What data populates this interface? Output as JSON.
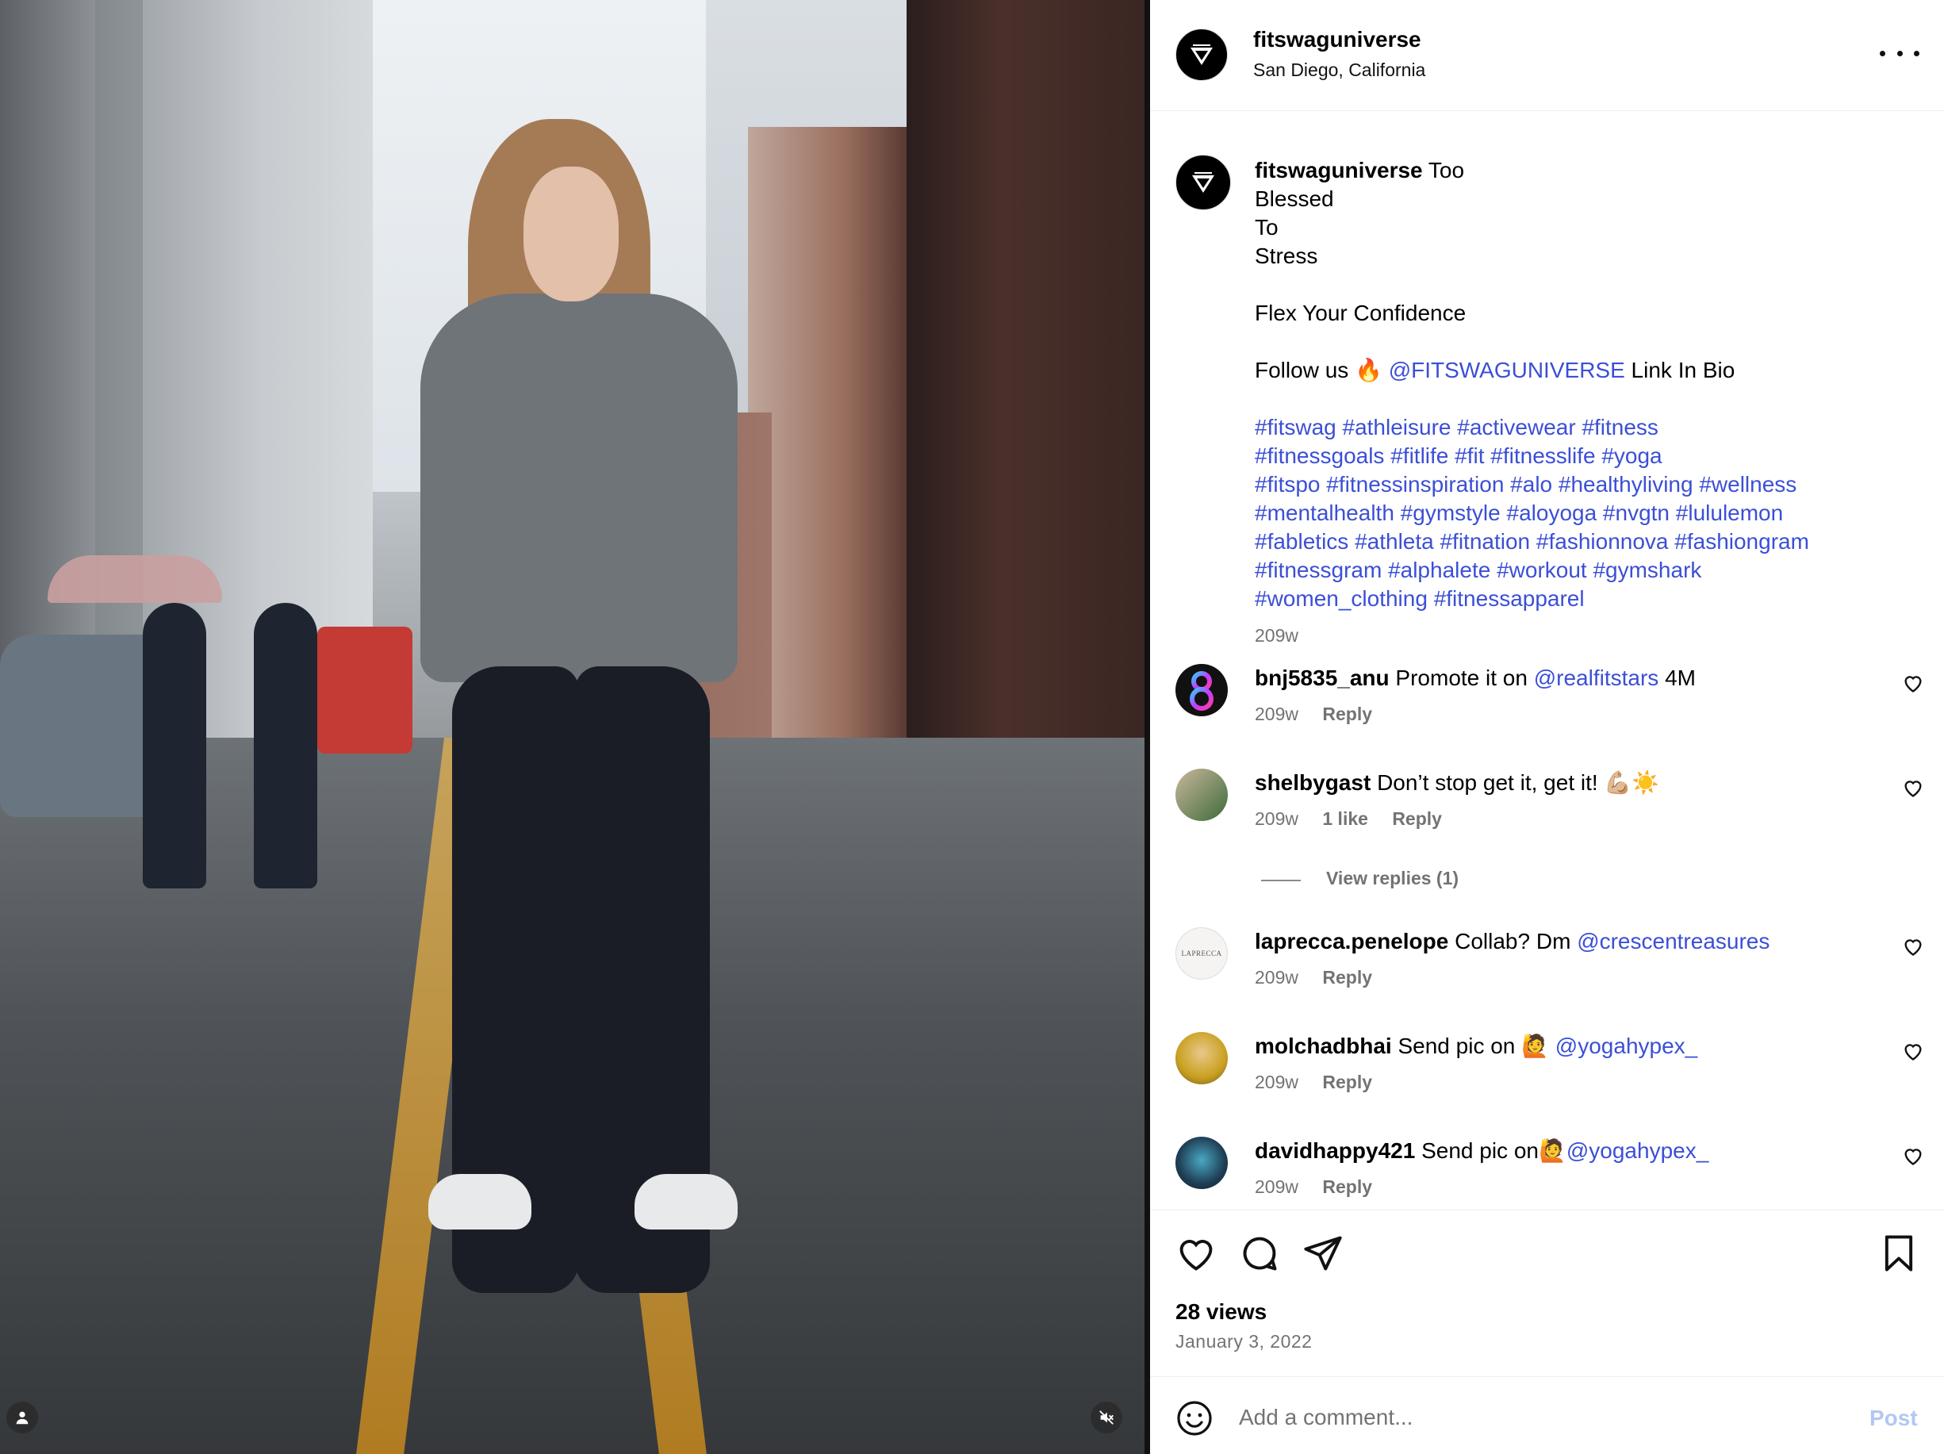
{
  "post": {
    "username": "fitswaguniverse",
    "location": "San Diego, California"
  },
  "caption": {
    "username": "fitswaguniverse",
    "line1": "Too",
    "line2": "Blessed",
    "line3": "To",
    "line4": "Stress",
    "line6": "Flex Your Confidence",
    "follow_prefix": "Follow us 🔥",
    "follow_mention": "@FITSWAGUNIVERSE",
    "follow_suffix": "Link In Bio",
    "hashtags": [
      "#fitswag #athleisure #activewear #fitness",
      "#fitnessgoals #fitlife #fit #fitnesslife #yoga",
      "#fitspo #fitnessinspiration #alo #healthyliving #wellness",
      "#mentalhealth #gymstyle #aloyoga  #nvgtn #lululemon",
      "#fabletics #athleta  #fitnation #fashionnova #fashiongram",
      "#fitnessgram #alphalete #workout  #gymshark",
      "#women_clothing  #fitnessapparel"
    ],
    "time": "209w"
  },
  "comments": [
    {
      "username": "bnj5835_anu",
      "text": "Promote it on",
      "mention": "@realfitstars",
      "suffix": "4M",
      "time": "209w",
      "likes": "",
      "reply": "Reply"
    },
    {
      "username": "shelbygast",
      "text": "Don’t stop get it, get it! 💪🏼☀️",
      "mention": "",
      "suffix": "",
      "time": "209w",
      "likes": "1 like",
      "reply": "Reply"
    },
    {
      "username": "laprecca.penelope",
      "text": "Collab? Dm",
      "mention": "@crescentreasures",
      "suffix": "",
      "time": "209w",
      "likes": "",
      "reply": "Reply"
    },
    {
      "username": "molchadbhai",
      "text": "Send pic on 🙋",
      "mention": "@yogahypex_",
      "suffix": "",
      "time": "209w",
      "likes": "",
      "reply": "Reply"
    },
    {
      "username": "davidhappy421",
      "text": "Send pic on🙋",
      "mention": "@yogahypex_",
      "suffix": "",
      "time": "209w",
      "likes": "",
      "reply": "Reply"
    }
  ],
  "view_replies": "View replies (1)",
  "laprecca_avatar_text": "LAPRECCA",
  "stats": {
    "views": "28 views",
    "date": "January 3, 2022"
  },
  "comment_box": {
    "placeholder": "Add a comment...",
    "post_label": "Post"
  },
  "icons": {
    "more": "more-options-icon",
    "like": "heart-icon",
    "comment": "comment-bubble-icon",
    "share": "paper-plane-icon",
    "save": "bookmark-icon",
    "emoji": "emoji-smile-icon",
    "user_tag": "user-tag-icon",
    "mute": "speaker-muted-icon"
  },
  "colors": {
    "link": "#3b4fd6",
    "secondary_text": "#737373",
    "post_button_disabled": "#b3c6f5"
  }
}
